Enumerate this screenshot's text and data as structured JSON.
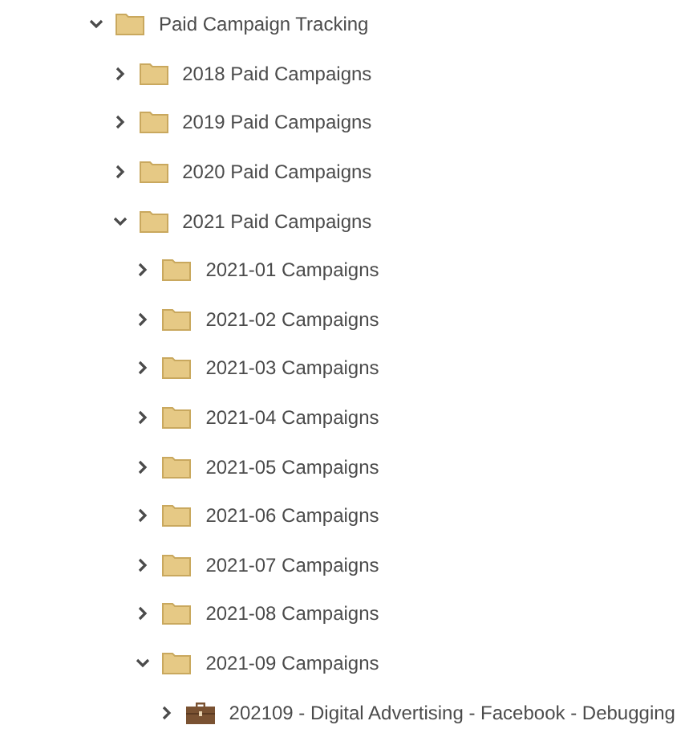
{
  "tree": [
    {
      "label": "Paid Campaign Tracking",
      "kind": "folder",
      "expanded": true,
      "children": [
        {
          "label": "2018 Paid Campaigns",
          "kind": "folder",
          "expanded": false
        },
        {
          "label": "2019 Paid Campaigns",
          "kind": "folder",
          "expanded": false
        },
        {
          "label": "2020 Paid Campaigns",
          "kind": "folder",
          "expanded": false
        },
        {
          "label": "2021 Paid Campaigns",
          "kind": "folder",
          "expanded": true,
          "children": [
            {
              "label": "2021-01 Campaigns",
              "kind": "folder",
              "expanded": false
            },
            {
              "label": "2021-02 Campaigns",
              "kind": "folder",
              "expanded": false
            },
            {
              "label": "2021-03 Campaigns",
              "kind": "folder",
              "expanded": false
            },
            {
              "label": "2021-04 Campaigns",
              "kind": "folder",
              "expanded": false
            },
            {
              "label": "2021-05 Campaigns",
              "kind": "folder",
              "expanded": false
            },
            {
              "label": "2021-06 Campaigns",
              "kind": "folder",
              "expanded": false
            },
            {
              "label": "2021-07 Campaigns",
              "kind": "folder",
              "expanded": false
            },
            {
              "label": "2021-08 Campaigns",
              "kind": "folder",
              "expanded": false
            },
            {
              "label": "2021-09 Campaigns",
              "kind": "folder",
              "expanded": true,
              "children": [
                {
                  "label": "202109 - Digital Advertising - Facebook - Debugging",
                  "kind": "project",
                  "expanded": false
                }
              ]
            }
          ]
        }
      ]
    }
  ]
}
